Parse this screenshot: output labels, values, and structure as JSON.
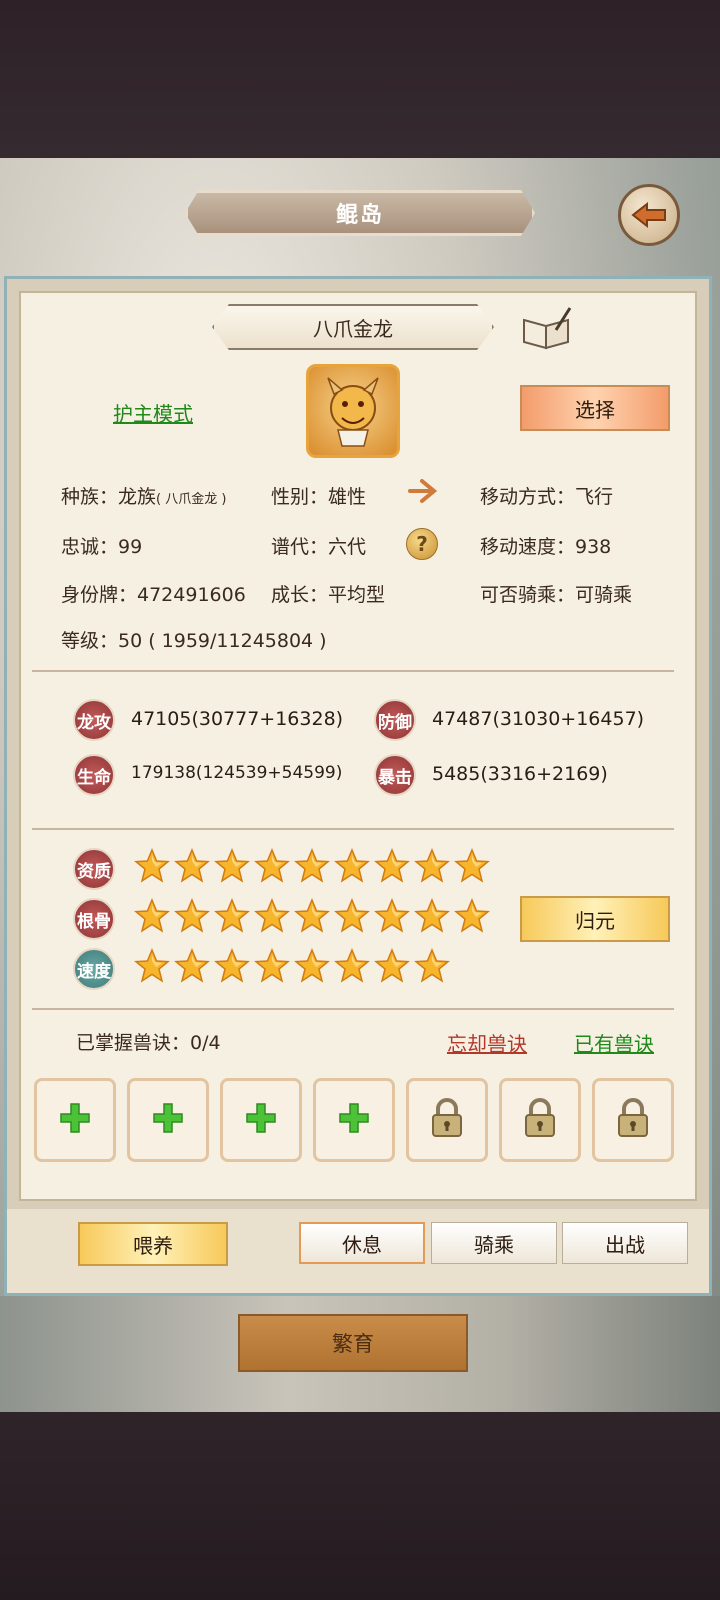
{
  "header": {
    "title": "鲲岛"
  },
  "pet": {
    "name": "八爪金龙",
    "mode_link": "护主模式",
    "select_label": "选择"
  },
  "info": {
    "race_label": "种族：龙族",
    "race_sub": "( 八爪金龙 )",
    "gender": "性别：雄性",
    "move_type": "移动方式：飞行",
    "loyalty": "忠诚：99",
    "generation": "谱代：六代",
    "move_speed": "移动速度：938",
    "id_tag": "身份牌：472491606",
    "growth": "成长：平均型",
    "rideable": "可否骑乘：可骑乘",
    "level": "等级：50 ( 1959/11245804 )"
  },
  "stats": [
    {
      "badge": "龙攻",
      "value": "47105(30777+16328)"
    },
    {
      "badge": "防御",
      "value": "47487(31030+16457)"
    },
    {
      "badge": "生命",
      "value": "179138(124539+54599)"
    },
    {
      "badge": "暴击",
      "value": "5485(3316+2169)"
    }
  ],
  "qualities": [
    {
      "label": "资质",
      "stars": 9
    },
    {
      "label": "根骨",
      "stars": 9
    },
    {
      "label": "速度",
      "stars": 8
    }
  ],
  "reset_label": "归元",
  "skills": {
    "mastered": "已掌握兽诀：0/4",
    "forget_link": "忘却兽诀",
    "owned_link": "已有兽诀",
    "slots": [
      "add",
      "add",
      "add",
      "add",
      "locked",
      "locked",
      "locked"
    ]
  },
  "actions": {
    "feed": "喂养",
    "rest": "休息",
    "ride": "骑乘",
    "battle": "出战",
    "breed": "繁育"
  }
}
